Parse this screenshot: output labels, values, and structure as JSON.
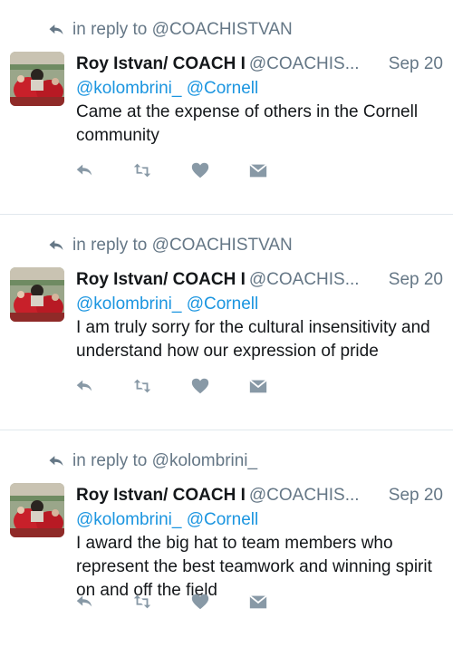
{
  "icons": {
    "reply_context": "reply-arrow-icon",
    "reply": "reply-icon",
    "retweet": "retweet-icon",
    "like": "heart-icon",
    "dm": "envelope-icon"
  },
  "colors": {
    "mention": "#1b95e0",
    "muted": "#657786",
    "action_icon": "#8899a6"
  },
  "tweets": [
    {
      "reply_to": "in reply to @COACHISTVAN",
      "name": "Roy Istvan/ COACH I",
      "handle": "@COACHIS...",
      "date": "Sep 20",
      "mentions": "@kolombrini_ @Cornell",
      "text": "Came at the expense of others in the Cornell community"
    },
    {
      "reply_to": "in reply to @COACHISTVAN",
      "name": "Roy Istvan/ COACH I",
      "handle": "@COACHIS...",
      "date": "Sep 20",
      "mentions": "@kolombrini_ @Cornell",
      "text": "I am truly sorry for the cultural insensitivity and understand how our expression  of pride"
    },
    {
      "reply_to": "in reply to @kolombrini_",
      "name": "Roy Istvan/ COACH I",
      "handle": "@COACHIS...",
      "date": "Sep 20",
      "mentions": "@kolombrini_ @Cornell",
      "text": "I award the big hat to team members who represent the best teamwork and winning spirit on and off the field"
    }
  ]
}
